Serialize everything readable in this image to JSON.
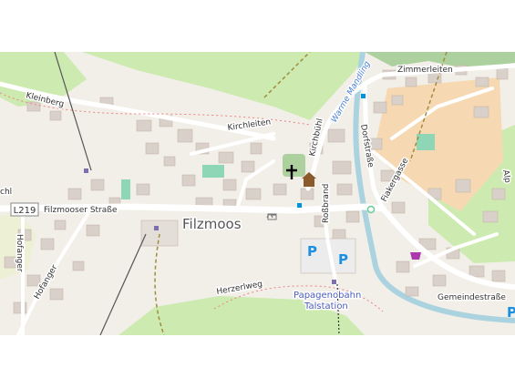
{
  "map": {
    "place_label": "Filzmoos",
    "road_ref": "L219",
    "streets": {
      "filzmooser_strasse": "Filzmooser Straße",
      "kleinberg": "Kleinberg",
      "kirchleiten": "Kirchleiten",
      "kirchbuhl": "Kirchbühl",
      "dorfstrasse": "Dorfstraße",
      "zimmerleiten": "Zimmerleiten",
      "fiakergasse": "Fiakergasse",
      "rossbrand": "Roßbrand",
      "herzerlweg": "Herzerlweg",
      "hofanger": "Hofanger",
      "hofanger_left": "Hofanger",
      "gemeindestrasse": "Gemeindestraße",
      "partial_left": "chl",
      "partial_right": "Alp"
    },
    "stream_label": "Warme Mandling",
    "poi": {
      "station_line1": "Papagenobahn",
      "station_line2": "Talstation"
    },
    "parking_symbol": "P",
    "colors": {
      "background": "#f2efe9",
      "meadow": "#cdebb0",
      "wood": "#add19e",
      "farmland": "#eef0d5",
      "school": "#f6d9b3",
      "water": "#aad3df",
      "building": "#d9d0c9",
      "road": "#ffffff",
      "parking": "#1d8fe0"
    },
    "icons": [
      "church-icon",
      "viewpoint-icon",
      "bus-stop-icon",
      "shop-icon",
      "amenity-icon"
    ]
  }
}
